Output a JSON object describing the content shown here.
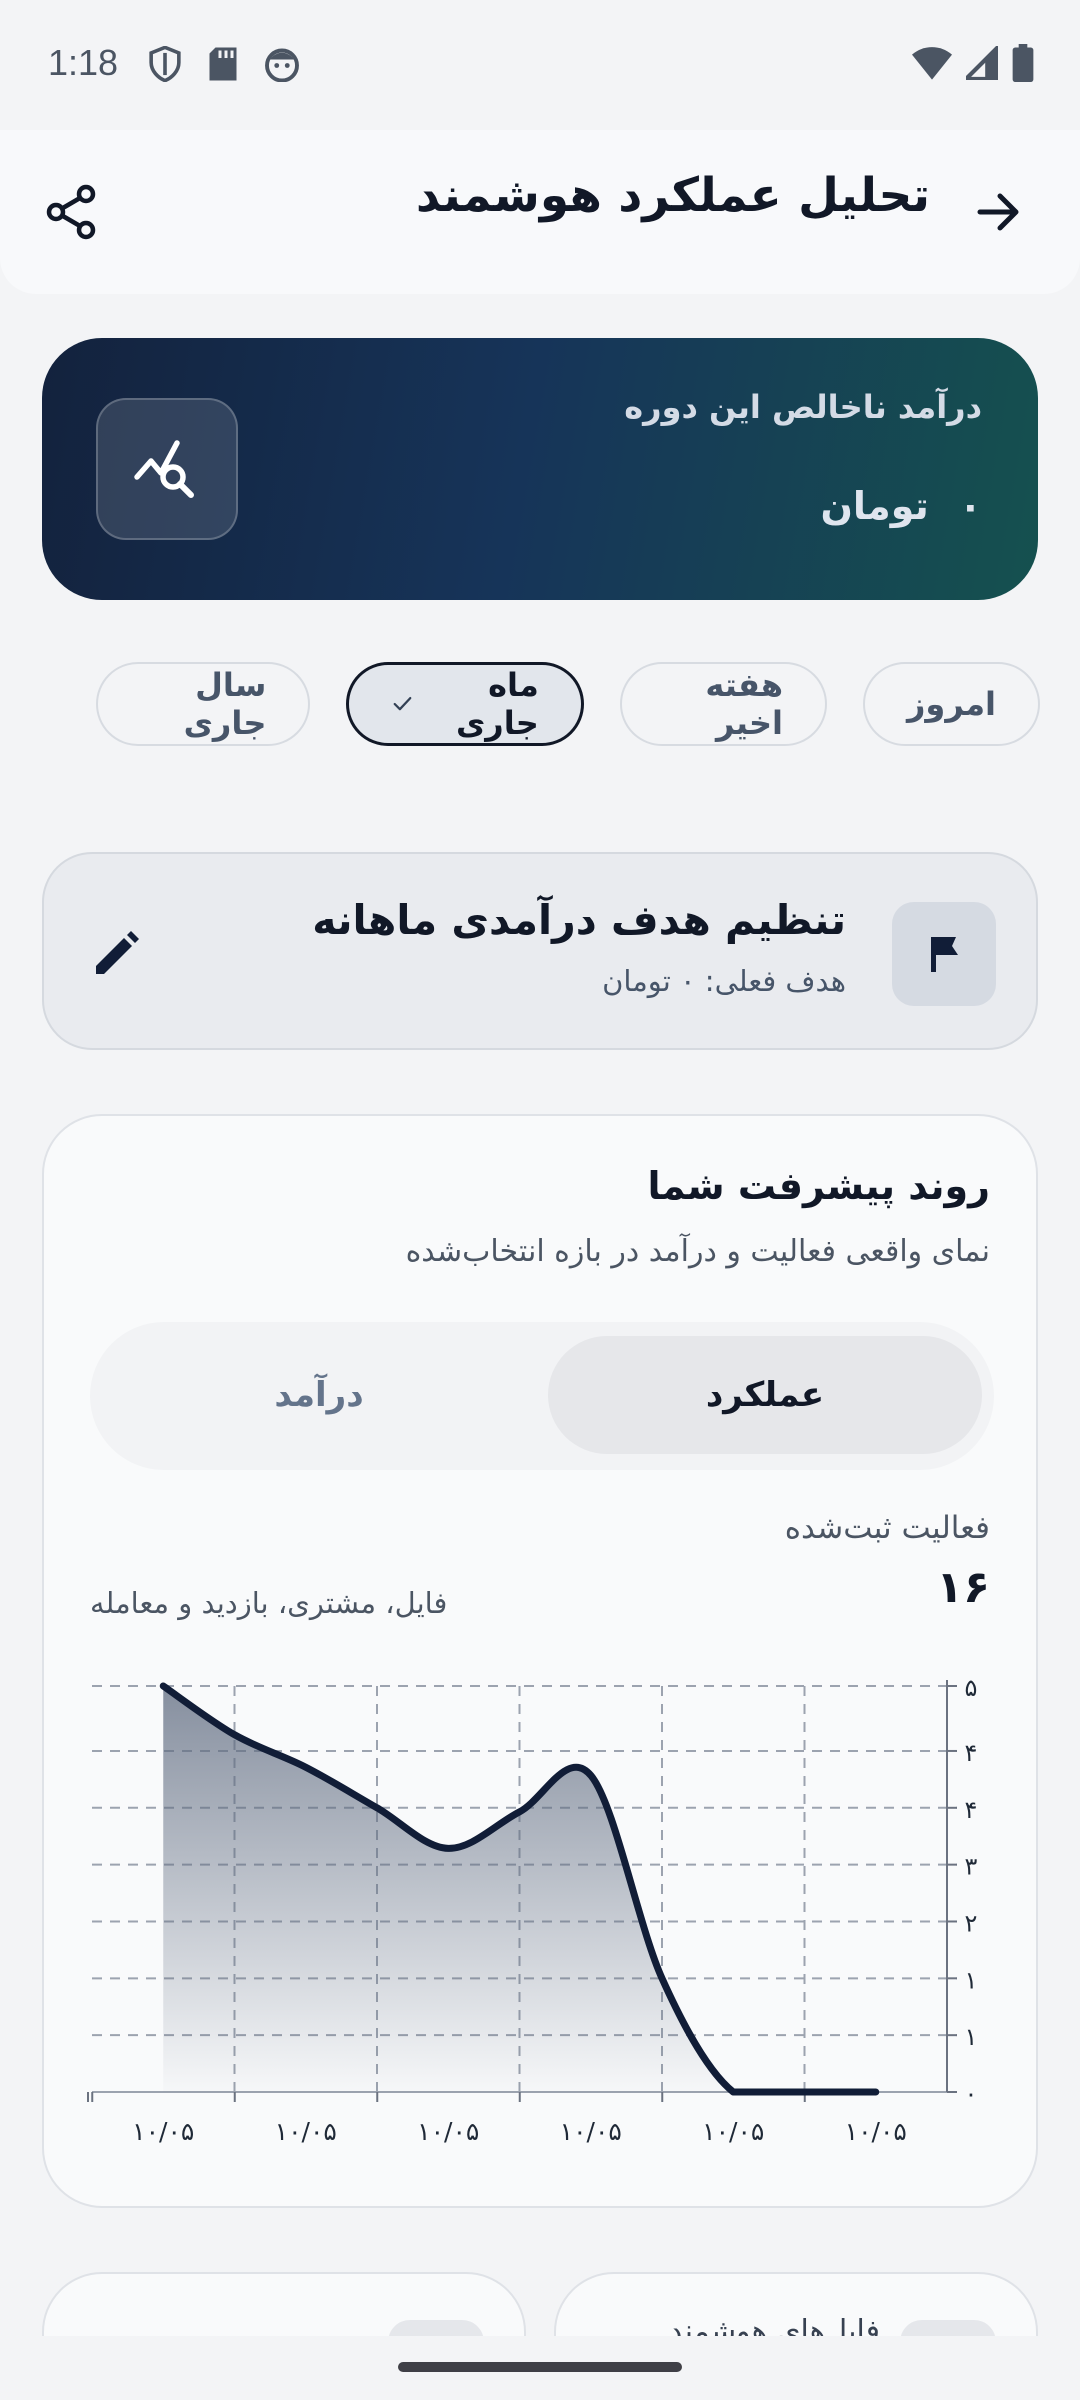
{
  "status_bar": {
    "time": "1:18"
  },
  "app_bar": {
    "title": "تحلیل عملکرد هوشمند"
  },
  "hero": {
    "label": "درآمد ناخالص این دوره",
    "value": "۰",
    "currency": "تومان"
  },
  "periods": [
    {
      "label": "امروز",
      "selected": false
    },
    {
      "label": "هفته اخیر",
      "selected": false
    },
    {
      "label": "ماه جاری",
      "selected": true
    },
    {
      "label": "سال جاری",
      "selected": false
    }
  ],
  "goal": {
    "title": "تنظیم هدف درآمدی ماهانه",
    "subtitle": "هدف فعلی: ۰ تومان"
  },
  "progress": {
    "title": "روند پیشرفت شما",
    "subtitle": "نمای واقعی فعالیت و درآمد در بازه انتخاب‌شده",
    "tabs": {
      "performance": "عملکرد",
      "income": "درآمد"
    },
    "metric_label": "فعالیت ثبت‌شده",
    "metric_value": "۱۶",
    "metric_desc": "فایل، مشتری، بازدید و معامله"
  },
  "chart_data": {
    "type": "area",
    "x_labels": [
      "۱۰/۰۵",
      "۱۰/۰۵",
      "۱۰/۰۵",
      "۱۰/۰۵",
      "۱۰/۰۵",
      "۱۰/۰۵"
    ],
    "y_tick_labels": [
      "۰",
      "۱",
      "۱",
      "۲",
      "۳",
      "۴",
      "۴",
      "۵"
    ],
    "y_ticks": [
      0,
      0.7,
      1.4,
      2.1,
      2.8,
      3.5,
      4.2,
      5
    ],
    "points": [
      {
        "x": 0.5,
        "y": 5.0
      },
      {
        "x": 1.0,
        "y": 4.4
      },
      {
        "x": 1.5,
        "y": 4.0
      },
      {
        "x": 2.0,
        "y": 3.5
      },
      {
        "x": 2.5,
        "y": 3.0
      },
      {
        "x": 3.0,
        "y": 3.45
      },
      {
        "x": 3.5,
        "y": 3.9
      },
      {
        "x": 4.0,
        "y": 1.4
      },
      {
        "x": 4.5,
        "y": 0.0
      },
      {
        "x": 5.0,
        "y": 0.0
      },
      {
        "x": 5.5,
        "y": 0.0
      }
    ],
    "x_range": [
      0,
      6
    ],
    "ylim": [
      0,
      5
    ],
    "grid": true,
    "line_color": "#111d37"
  },
  "bottom_cards": [
    {
      "title": "فایل‌های هوشمند"
    },
    {
      "title": ""
    }
  ]
}
